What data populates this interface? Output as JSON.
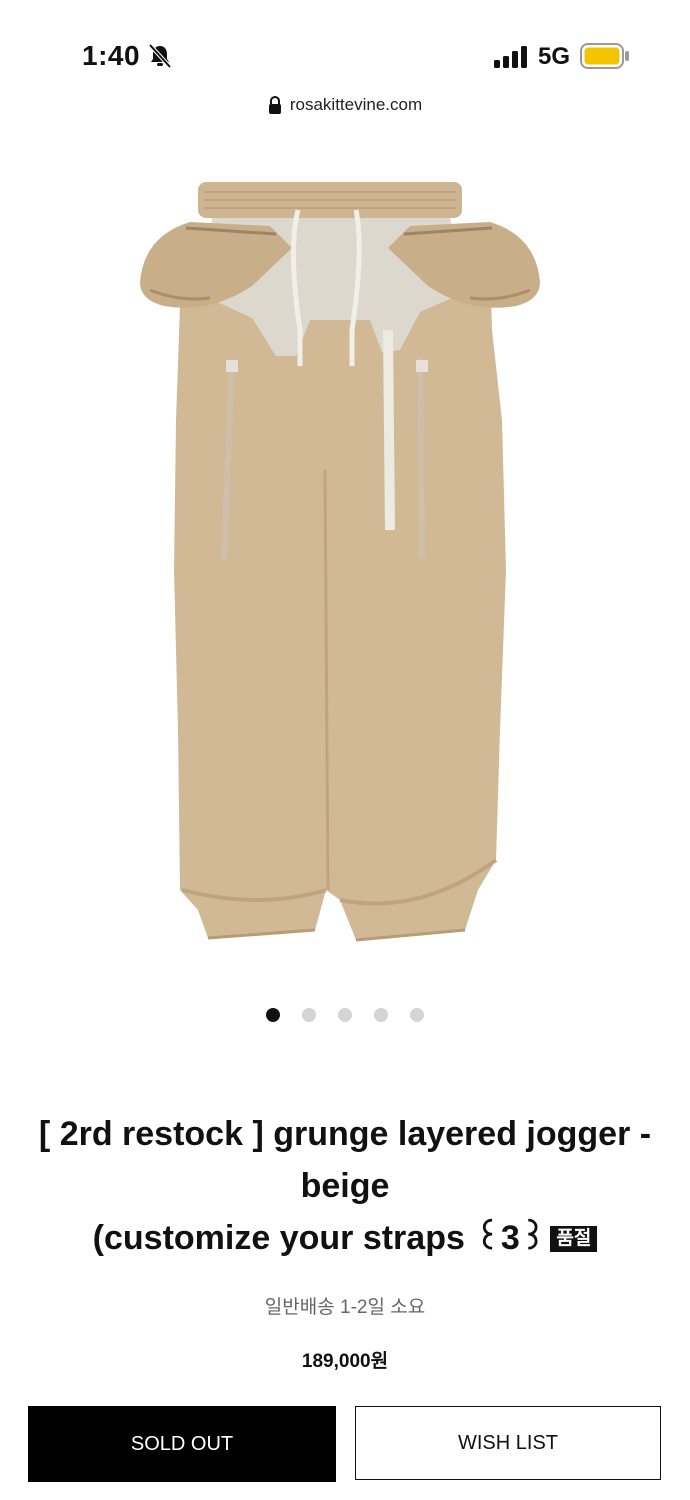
{
  "status_bar": {
    "time": "1:40",
    "network": "5G",
    "battery_color": "#F5C400"
  },
  "browser": {
    "url": "rosakittevine.com"
  },
  "gallery": {
    "image_count": 5,
    "active_index": 0
  },
  "product": {
    "title_line1": "[ 2rd restock ] grunge layered jogger - beige",
    "title_line2": "(customize your straps ꒰3꒱",
    "soldout_badge": "품절",
    "shipping": "일반배송 1-2일 소요",
    "price": "189,000원"
  },
  "actions": {
    "sold_out_label": "SOLD OUT",
    "wishlist_label": "WISH LIST"
  },
  "colors": {
    "pants_main": "#D2B996",
    "pants_shadow": "#BFA47F",
    "lining": "#DDD8CE"
  }
}
